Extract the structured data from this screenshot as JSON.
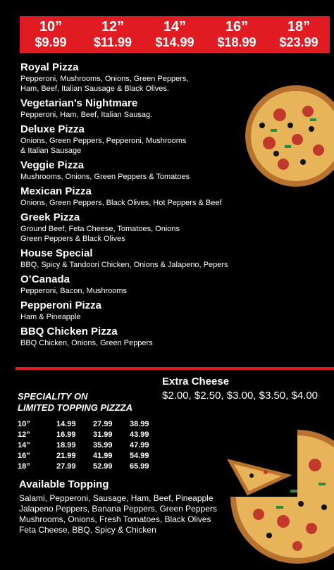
{
  "prices": [
    {
      "size": "10”",
      "price": "$9.99"
    },
    {
      "size": "12”",
      "price": "$11.99"
    },
    {
      "size": "14”",
      "price": "$14.99"
    },
    {
      "size": "16”",
      "price": "$18.99"
    },
    {
      "size": "18”",
      "price": "$23.99"
    }
  ],
  "items": [
    {
      "name": "Royal Pizza",
      "desc": [
        "Pepperoni, Mushrooms, Onions, Green Peppers,",
        "Ham, Beef, Italian Sausage & Black Olives."
      ]
    },
    {
      "name": "Vegetarian’s Nightmare",
      "desc": [
        "Pepperoni, Ham, Beef, Italian Sausag."
      ]
    },
    {
      "name": "Deluxe Pizza",
      "desc": [
        "Onions, Green Peppers, Pepperoni, Mushrooms",
        "& Italian Sausage"
      ]
    },
    {
      "name": "Veggie Pizza",
      "desc": [
        "Mushrooms, Onions, Green Peppers & Tomatoes"
      ]
    },
    {
      "name": "Mexican Pizza",
      "desc": [
        "Onions, Green Peppers, Black Olives, Hot Peppers & Beef"
      ]
    },
    {
      "name": "Greek Pizza",
      "desc": [
        "Ground Beef, Feta Cheese, Tomatoes, Onions",
        "Green Peppers & Black Olives"
      ]
    },
    {
      "name": "House Special",
      "desc": [
        "BBQ, Spicy & Tandoori Chicken, Onions & Jalapeno, Pepers"
      ]
    },
    {
      "name": "O’Canada",
      "desc": [
        "Pepperoni, Bacon, Mushrooms"
      ]
    },
    {
      "name": "Pepperoni Pizza",
      "desc": [
        "Ham & Pineapple"
      ]
    },
    {
      "name": "BBQ Chicken Pizza",
      "desc": [
        "BBQ Chicken, Onions, Green Peppers"
      ]
    }
  ],
  "extra_cheese": {
    "title": "Extra Cheese",
    "prices": "$2.00, $2.50, $3.00, $3.50, $4.00"
  },
  "speciality": {
    "title_line1": "SPECIALITY ON",
    "title_line2": "LIMITED TOPPING PIZZZA",
    "rows": [
      [
        "10”",
        "14.99",
        "27.99",
        "38.99"
      ],
      [
        "12”",
        "16.99",
        "31.99",
        "43.99"
      ],
      [
        "14”",
        "18.99",
        "35.99",
        "47.99"
      ],
      [
        "16”",
        "21.99",
        "41.99",
        "54.99"
      ],
      [
        "18”",
        "27.99",
        "52.99",
        "65.99"
      ]
    ]
  },
  "toppings": {
    "title": "Available Topping",
    "lines": [
      "Salami, Pepperoni, Sausage, Ham, Beef, Pineapple",
      "Jalapeno Peppers, Banana Peppers, Green Peppers",
      "Mushrooms, Onions, Fresh Tomatoes, Black Olives",
      "Feta Cheese, BBQ, Spicy & Chicken"
    ]
  },
  "colors": {
    "accent": "#e01b22",
    "background": "#000000",
    "text": "#ffffff"
  }
}
